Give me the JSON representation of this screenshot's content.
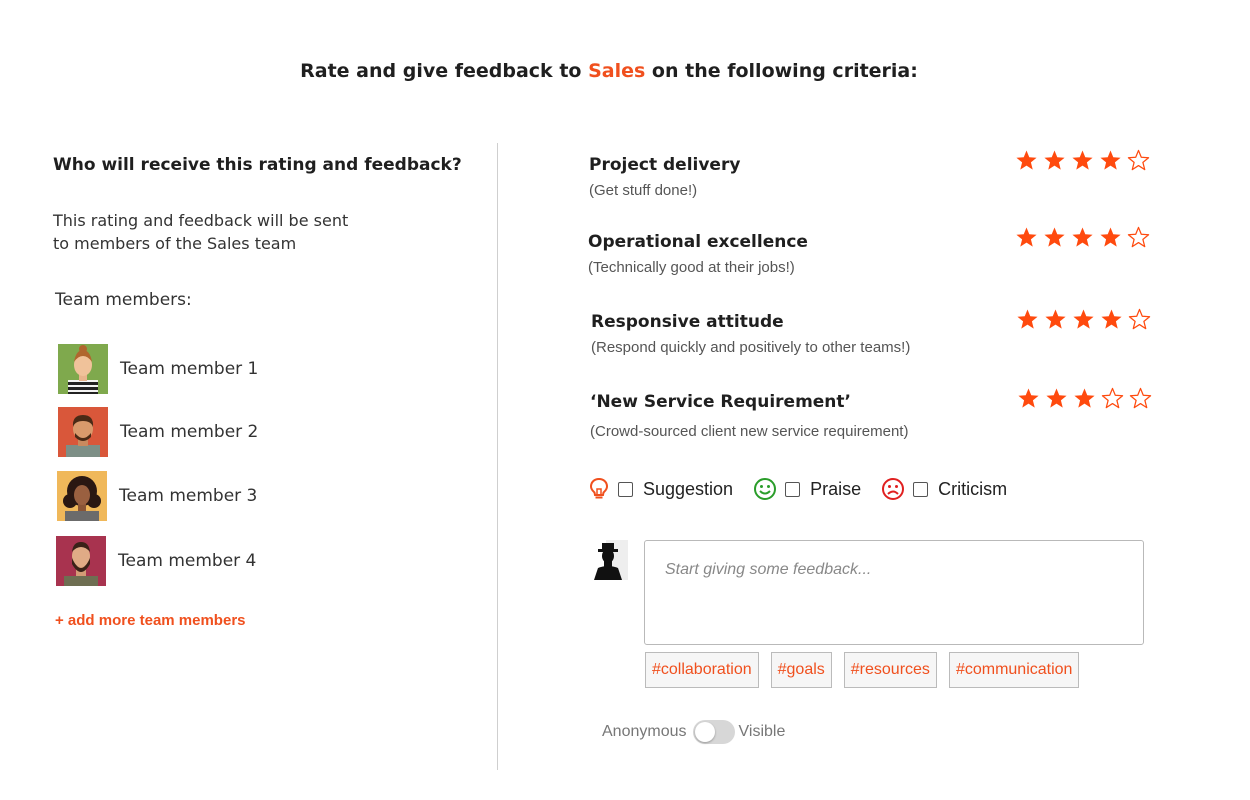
{
  "heading": {
    "prefix": "Rate and give feedback to",
    "team": "Sales",
    "suffix": "on the following criteria:"
  },
  "recipients": {
    "title": "Who will receive this rating and feedback?",
    "description_line1": "This rating and feedback will be sent",
    "description_line2": "to members of the Sales team",
    "team_label": "Team members:",
    "members": [
      {
        "name": "Team member 1",
        "avatar_bg": "#7fa94d"
      },
      {
        "name": "Team member 2",
        "avatar_bg": "#d9573a"
      },
      {
        "name": "Team member 3",
        "avatar_bg": "#f0b85a"
      },
      {
        "name": "Team member 4",
        "avatar_bg": "#a8334f"
      }
    ],
    "add_more": "+ add more team members"
  },
  "criteria": [
    {
      "title": "Project delivery",
      "subtitle": "(Get stuff done!)",
      "rating": 4,
      "max": 5
    },
    {
      "title": "Operational excellence",
      "subtitle": "(Technically good at their jobs!)",
      "rating": 4,
      "max": 5
    },
    {
      "title": "Responsive attitude",
      "subtitle": "(Respond quickly and positively to other teams!)",
      "rating": 4,
      "max": 5
    },
    {
      "title": "‘New Service Requirement’",
      "subtitle": "(Crowd-sourced client new service requirement)",
      "rating": 3,
      "max": 5
    }
  ],
  "feedback_types": [
    {
      "label": "Suggestion",
      "icon": "lightbulb-icon",
      "color": "#f0501e",
      "checked": false
    },
    {
      "label": "Praise",
      "icon": "smiley-icon",
      "color": "#2a9d2a",
      "checked": false
    },
    {
      "label": "Criticism",
      "icon": "frown-icon",
      "color": "#e02020",
      "checked": false
    }
  ],
  "feedback": {
    "placeholder": "Start giving some feedback...",
    "tags": [
      "#collaboration",
      "#goals",
      "#resources",
      "#communication"
    ]
  },
  "visibility": {
    "left_label": "Anonymous",
    "right_label": "Visible",
    "anonymous": false
  },
  "colors": {
    "accent": "#f0501e",
    "star": "#ff4a0e"
  }
}
